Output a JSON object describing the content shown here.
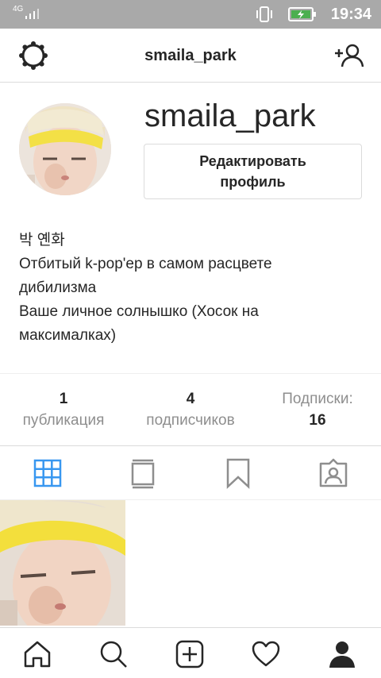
{
  "status_bar": {
    "network": "4G",
    "time": "19:34",
    "icons": [
      "signal-icon",
      "vibrate-icon",
      "battery-charging-icon"
    ]
  },
  "header": {
    "title": "smaila_park",
    "left_icon": "settings-gear-icon",
    "right_icon": "add-user-icon"
  },
  "profile": {
    "username": "smaila_park",
    "edit_button_line1": "Редактировать",
    "edit_button_line2": "профиль",
    "bio": [
      "박 옌화",
      "Отбитый k-pop'ер в самом расцвете",
      "дибилизма",
      "Ваше личное солнышко (Хосок на",
      "максималках)"
    ]
  },
  "stats": {
    "posts": {
      "value": "1",
      "label": "публикация"
    },
    "followers": {
      "value": "4",
      "label": "подписчиков"
    },
    "following": {
      "label": "Подписки:",
      "value": "16"
    }
  },
  "tabs": [
    "grid-icon",
    "feed-icon",
    "saved-bookmark-icon",
    "tagged-icon"
  ],
  "active_tab": "grid-icon",
  "accent_color": "#3897f0",
  "bottom_nav": [
    "home-icon",
    "search-icon",
    "add-post-icon",
    "heart-icon",
    "profile-icon"
  ]
}
